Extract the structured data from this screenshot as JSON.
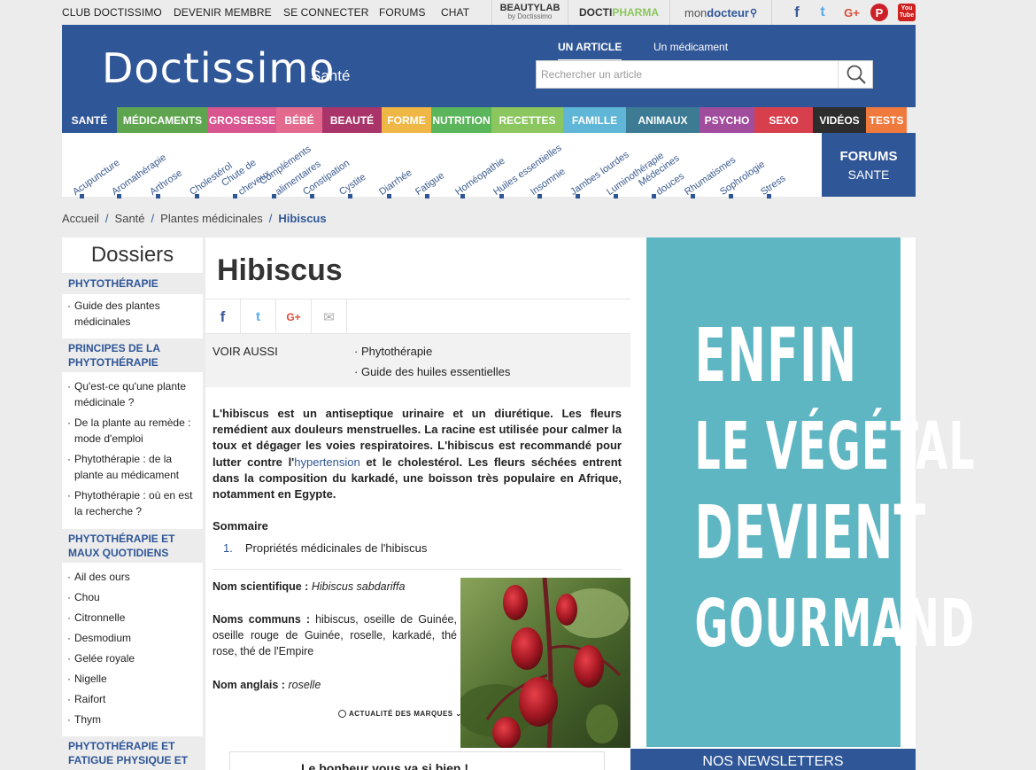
{
  "topbar": {
    "links": [
      "CLUB DOCTISSIMO",
      "DEVENIR MEMBRE",
      "SE CONNECTER",
      "FORUMS",
      "CHAT"
    ],
    "partners": {
      "beautylab": "BEAUTYLAB",
      "beautylab_sub": "by Doctissimo",
      "doctipharma": "DOCTI",
      "doctipharma_b": "PHARMA",
      "mondocteur": "mon",
      "mondocteur_b": "docteur"
    },
    "social": {
      "facebook": "f",
      "twitter": "t",
      "googleplus": "G+",
      "pinterest": "P",
      "youtube_a": "You",
      "youtube_b": "Tube"
    }
  },
  "header": {
    "logo": "Doctissimo",
    "logo_sub": "Santé",
    "search_tab_article": "UN ARTICLE",
    "search_tab_medicament": "Un médicament",
    "search_placeholder": "Rechercher un article"
  },
  "categories": [
    {
      "label": "SANTÉ",
      "color": "#2f5697"
    },
    {
      "label": "MÉDICAMENTS",
      "color": "#5fa54f"
    },
    {
      "label": "GROSSESSE",
      "color": "#d9558f"
    },
    {
      "label": "BÉBÉ",
      "color": "#e36a8e"
    },
    {
      "label": "BEAUTÉ",
      "color": "#a9346a"
    },
    {
      "label": "FORME",
      "color": "#efb846"
    },
    {
      "label": "NUTRITION",
      "color": "#5ab55b"
    },
    {
      "label": "RECETTES",
      "color": "#8bc65e"
    },
    {
      "label": "FAMILLE",
      "color": "#5fb6d6"
    },
    {
      "label": "ANIMAUX",
      "color": "#3c7b93"
    },
    {
      "label": "PSYCHO",
      "color": "#a14d9d"
    },
    {
      "label": "SEXO",
      "color": "#d73f4d"
    },
    {
      "label": "VIDÉOS",
      "color": "#2d2d2d"
    },
    {
      "label": "TESTS",
      "color": "#f07a3e"
    }
  ],
  "tags": [
    "Acupuncture",
    "Aromathérapie",
    "Arthrose",
    "Cholestérol",
    "Chute de",
    "cheveux",
    "Compléments",
    "alimentaires",
    "Constipation",
    "Cystite",
    "Diarrhée",
    "Fatigue",
    "Homéopathie",
    "Huiles essentielles",
    "Insomnie",
    "Jambes lourdes",
    "Luminothérapie",
    "Médecines",
    "douces",
    "Rhumatismes",
    "Sophrologie",
    "Stress"
  ],
  "forums": {
    "title": "FORUMS",
    "sub": "SANTE"
  },
  "breadcrumb": {
    "home": "Accueil",
    "level1": "Santé",
    "level2": "Plantes médicinales",
    "current": "Hibiscus"
  },
  "sidebar": {
    "title": "Dossiers",
    "sections": [
      {
        "head": "PHYTOTHÉRAPIE",
        "items": [
          "Guide des plantes médicinales"
        ]
      },
      {
        "head": "PRINCIPES DE LA PHYTOTHÉRAPIE",
        "items": [
          "Qu'est-ce qu'une plante médicinale ?",
          "De la plante au remède : mode d'emploi",
          "Phytothérapie : de la plante au médicament",
          "Phytothérapie : où en est la recherche ?"
        ]
      },
      {
        "head": "PHYTOTHÉRAPIE ET MAUX QUOTIDIENS",
        "items": [
          "Ail des ours",
          "Chou",
          "Citronnelle",
          "Desmodium",
          "Gelée royale",
          "Nigelle",
          "Raifort",
          "Thym"
        ]
      },
      {
        "head": "PHYTOTHÉRAPIE ET FATIGUE PHYSIQUE ET",
        "items": []
      }
    ]
  },
  "article": {
    "title": "Hibiscus",
    "share": {
      "facebook": "f",
      "twitter": "t",
      "googleplus": "G+",
      "email": "✉"
    },
    "voir_aussi": "VOIR AUSSI",
    "voir_links": [
      "Phytothérapie",
      "Guide des huiles essentielles"
    ],
    "intro_a": "L'hibiscus est un antiseptique urinaire et un diurétique. Les fleurs remédient aux douleurs menstruelles. La racine est utilisée pour calmer la toux et dégager les voies respiratoires. L'hibiscus est recommandé pour lutter contre l'",
    "intro_link": "hypertension",
    "intro_b": " et le cholestérol. Les fleurs séchées entrent dans la composition du karkadé, une boisson très populaire en Afrique, notamment en Egypte.",
    "sommaire_title": "Sommaire",
    "sommaire_num": "1.",
    "sommaire_item": "Propriétés médicinales de l'hibiscus",
    "sci_label": "Nom scientifique :",
    "sci_value": "Hibiscus sabdariffa",
    "common_label": "Noms communs :",
    "common_value": "hibiscus, oseille de Guinée, oseille rouge de Guinée, roselle, karkadé, thé rose, thé de l'Empire",
    "english_label": "Nom anglais :",
    "english_value": "roselle",
    "marques": "ACTUALITÉ DES MARQUES",
    "promo": "Le bonheur vous va si bien !"
  },
  "ad": {
    "line1": "ENFIN",
    "line2": "LE VÉGÉTAL",
    "line3": "DEVIENT",
    "line4": "GOURMAND",
    "bg": "#5fb6c3"
  },
  "newsletter": "NOS NEWSLETTERS"
}
